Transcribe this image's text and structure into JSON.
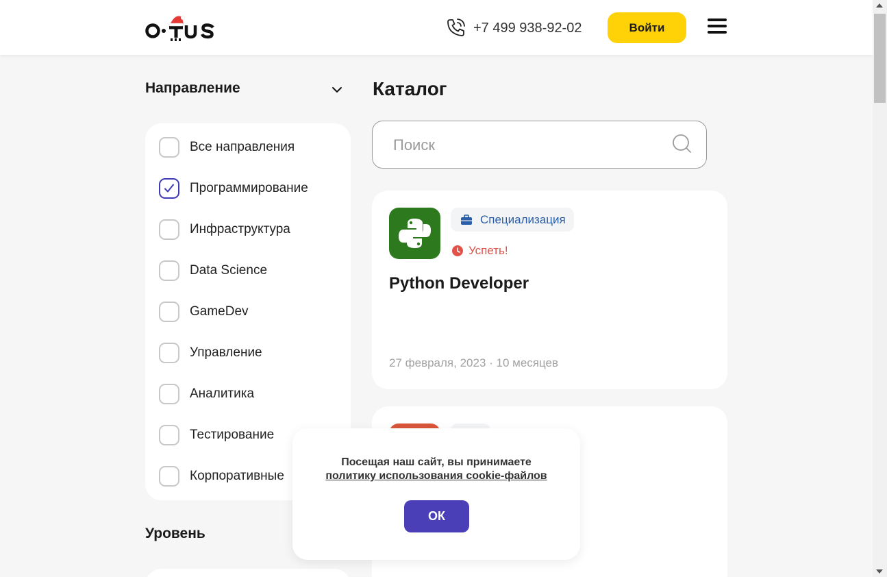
{
  "header": {
    "logo_text": "otus",
    "phone": "+7 499 938-92-02",
    "login_label": "Войти",
    "brand_color": "#ffd208"
  },
  "sidebar": {
    "direction_title": "Направление",
    "items": [
      {
        "label": "Все направления",
        "checked": false
      },
      {
        "label": "Программирование",
        "checked": true
      },
      {
        "label": "Инфраструктура",
        "checked": false
      },
      {
        "label": "Data Science",
        "checked": false
      },
      {
        "label": "GameDev",
        "checked": false
      },
      {
        "label": "Управление",
        "checked": false
      },
      {
        "label": "Аналитика",
        "checked": false
      },
      {
        "label": "Тестирование",
        "checked": false
      },
      {
        "label": "Корпоративные",
        "checked": false
      }
    ],
    "level_title": "Уровень"
  },
  "main": {
    "title": "Каталог",
    "search": {
      "placeholder": "Поиск",
      "value": ""
    },
    "cards": [
      {
        "image_icon": "python-logo-icon",
        "tag_label": "Специализация",
        "tag_icon": "briefcase-icon",
        "hurry_label": "Успеть!",
        "title": "Python Developer",
        "meta": "27 февраля, 2023 · 10 месяцев"
      }
    ]
  },
  "cookie": {
    "text": "Посещая наш сайт, вы принимаете",
    "link": "политику использования cookie-файлов",
    "ok_label": "ОК",
    "accent": "#4b3fb8"
  }
}
